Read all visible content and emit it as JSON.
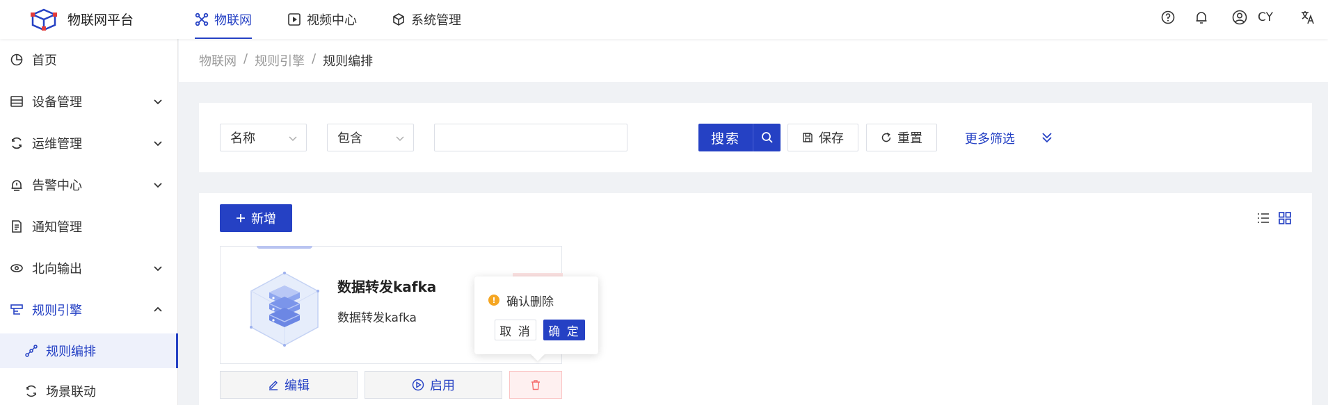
{
  "header": {
    "app_title": "物联网平台",
    "tabs": [
      {
        "label": "物联网",
        "icon": "iot-icon",
        "active": true
      },
      {
        "label": "视频中心",
        "icon": "video-icon",
        "active": false
      },
      {
        "label": "系统管理",
        "icon": "system-icon",
        "active": false
      }
    ],
    "user_name": "CY",
    "accent": "#2541c4"
  },
  "sidebar": {
    "items": [
      {
        "label": "首页",
        "icon": "pie-chart-icon"
      },
      {
        "label": "设备管理",
        "icon": "device-icon",
        "has_children": true
      },
      {
        "label": "运维管理",
        "icon": "ops-icon",
        "has_children": true
      },
      {
        "label": "告警中心",
        "icon": "alarm-icon",
        "has_children": true
      },
      {
        "label": "通知管理",
        "icon": "notice-icon"
      },
      {
        "label": "北向输出",
        "icon": "output-icon",
        "has_children": true
      },
      {
        "label": "规则引擎",
        "icon": "rule-engine-icon",
        "has_children": true,
        "open": true
      }
    ],
    "subitems": [
      {
        "label": "规则编排",
        "icon": "flow-icon",
        "active": true
      },
      {
        "label": "场景联动",
        "icon": "scene-icon"
      }
    ]
  },
  "breadcrumb": {
    "items": [
      "物联网",
      "规则引擎",
      "规则编排"
    ]
  },
  "filter": {
    "field_select": "名称",
    "op_select": "包含",
    "value": "",
    "search_label": "搜索",
    "save_label": "保存",
    "reset_label": "重置",
    "more_label": "更多筛选"
  },
  "content": {
    "add_label": "新增",
    "card": {
      "title": "数据转发kafka",
      "description": "数据转发kafka",
      "edit_label": "编辑",
      "enable_label": "启用"
    }
  },
  "popconfirm": {
    "message": "确认删除",
    "cancel_label": "取 消",
    "ok_label": "确 定"
  }
}
